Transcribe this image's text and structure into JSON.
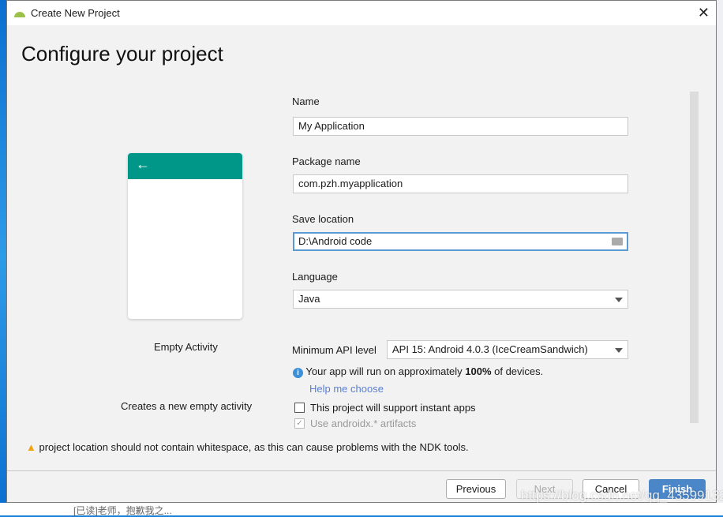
{
  "window": {
    "title": "Create New Project",
    "heading": "Configure your project"
  },
  "template": {
    "name": "Empty Activity",
    "description": "Creates a new empty activity"
  },
  "form": {
    "name_label": "Name",
    "name_value": "My Application",
    "package_label": "Package name",
    "package_value": "com.pzh.myapplication",
    "location_label": "Save location",
    "location_value": "D:\\Android code",
    "language_label": "Language",
    "language_value": "Java",
    "api_label": "Minimum API level",
    "api_value": "API 15: Android 4.0.3 (IceCreamSandwich)",
    "info_pre": "Your app will run on approximately ",
    "info_bold": "100%",
    "info_post": " of devices.",
    "help_link": "Help me choose",
    "instant_label": "This project will support instant apps",
    "instant_checked": false,
    "androidx_label": "Use androidx.* artifacts",
    "androidx_checked": true
  },
  "warning": "project location should not contain whitespace, as this can cause problems with the NDK tools.",
  "buttons": {
    "previous": "Previous",
    "next": "Next",
    "cancel": "Cancel",
    "finish": "Finish"
  },
  "background": {
    "chat_preview": "[已读]老师，抱歉我之...",
    "watermark": "https://blog.csdn.net/qq_43599132"
  },
  "colors": {
    "accent": "#009688",
    "primary_button": "#4a86c8",
    "link": "#5a7fd1"
  }
}
